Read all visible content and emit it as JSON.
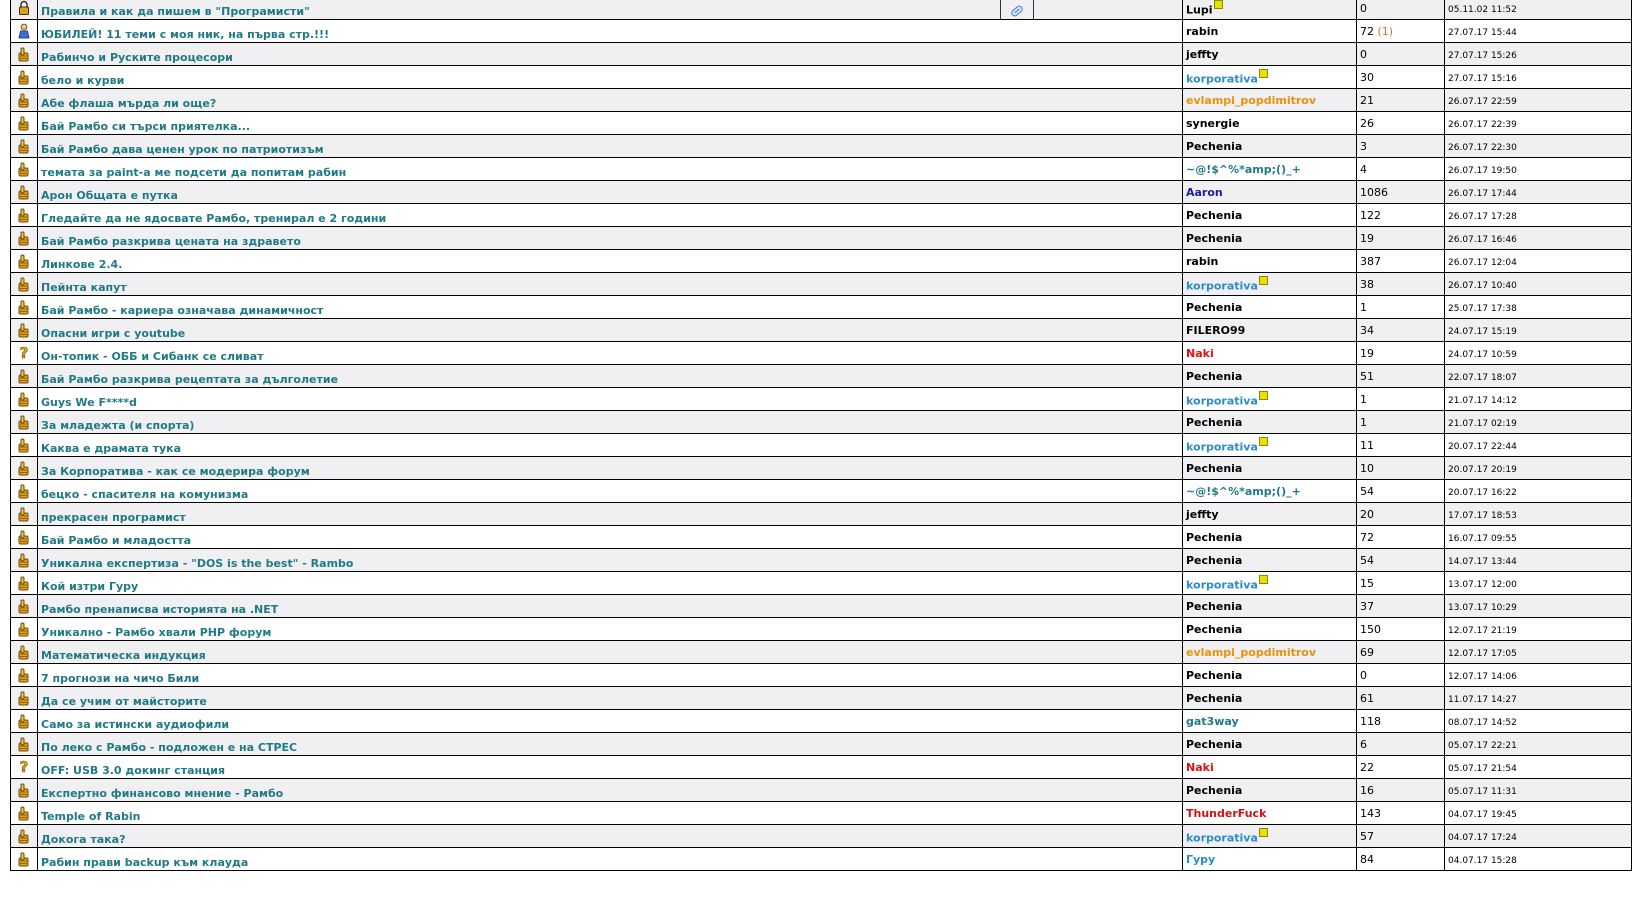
{
  "colors": {
    "title": "#1f7a85",
    "name_black": "#000000",
    "name_blue": "#2a8ccc",
    "name_orange": "#e8920c",
    "name_navy": "#1b1ba8",
    "name_red": "#dd1111",
    "name_teal": "#1f7a85",
    "name_darkred": "#cc1111",
    "new_count": "#e07030"
  },
  "topics": [
    {
      "icon": "lock-icon",
      "title": "Правила и как да пишем в \"Програмисти\"",
      "author": "Lupi",
      "author_color": "name_black",
      "badge": true,
      "replies": "0",
      "new": "",
      "date": "05.11.02 11:52"
    },
    {
      "icon": "person-icon",
      "title": "ЮБИЛЕЙ! 11 теми с моя ник, на първа стр.!!!",
      "author": "rabin",
      "author_color": "name_black",
      "badge": false,
      "replies": "72",
      "new": "(1)",
      "date": "27.07.17 15:44"
    },
    {
      "icon": "thumb-icon",
      "title": "Рабинчо и Руските процесори",
      "author": "jeffty",
      "author_color": "name_black",
      "badge": false,
      "replies": "0",
      "new": "",
      "date": "27.07.17 15:26"
    },
    {
      "icon": "thumb-icon",
      "title": "бело и курви",
      "author": "korporativa",
      "author_color": "name_blue",
      "badge": true,
      "replies": "30",
      "new": "",
      "date": "27.07.17 15:16"
    },
    {
      "icon": "thumb-icon",
      "title": "Абе флаша мърда ли още?",
      "author": "evlampi_popdimitrov",
      "author_color": "name_orange",
      "badge": false,
      "replies": "21",
      "new": "",
      "date": "26.07.17 22:59"
    },
    {
      "icon": "thumb-icon",
      "title": "Бай Рамбо си търси приятелка...",
      "author": "synergie",
      "author_color": "name_black",
      "badge": false,
      "replies": "26",
      "new": "",
      "date": "26.07.17 22:39"
    },
    {
      "icon": "thumb-icon",
      "title": "Бай Рамбо дава ценен урок по патриотизъм",
      "author": "Pechenia",
      "author_color": "name_black",
      "badge": false,
      "replies": "3",
      "new": "",
      "date": "26.07.17 22:30"
    },
    {
      "icon": "thumb-icon",
      "title": "темата за paint-а ме подсети да попитам рабин",
      "author": "~@!$^%*amp;()_+",
      "author_color": "name_teal",
      "badge": false,
      "replies": "4",
      "new": "",
      "date": "26.07.17 19:50"
    },
    {
      "icon": "thumb-icon",
      "title": "Арон Общата е путка",
      "author": "Aaron",
      "author_color": "name_navy",
      "badge": false,
      "replies": "1086",
      "new": "",
      "date": "26.07.17 17:44"
    },
    {
      "icon": "thumb-icon",
      "title": "Гледайте да не ядосвате Рамбо, тренирал е 2 години",
      "author": "Pechenia",
      "author_color": "name_black",
      "badge": false,
      "replies": "122",
      "new": "",
      "date": "26.07.17 17:28"
    },
    {
      "icon": "thumb-icon",
      "title": "Бай Рамбо разкрива цената на здравето",
      "author": "Pechenia",
      "author_color": "name_black",
      "badge": false,
      "replies": "19",
      "new": "",
      "date": "26.07.17 16:46"
    },
    {
      "icon": "thumb-icon",
      "title": "Линкове 2.4.",
      "author": "rabin",
      "author_color": "name_black",
      "badge": false,
      "replies": "387",
      "new": "",
      "date": "26.07.17 12:04"
    },
    {
      "icon": "thumb-icon",
      "title": "Пейнта капут",
      "author": "korporativa",
      "author_color": "name_blue",
      "badge": true,
      "replies": "38",
      "new": "",
      "date": "26.07.17 10:40"
    },
    {
      "icon": "thumb-icon",
      "title": "Бай Рамбо - кариера означава динамичност",
      "author": "Pechenia",
      "author_color": "name_black",
      "badge": false,
      "replies": "1",
      "new": "",
      "date": "25.07.17 17:38"
    },
    {
      "icon": "thumb-icon",
      "title": "Опасни игри с youtube",
      "author": "FILERO99",
      "author_color": "name_black",
      "badge": false,
      "replies": "34",
      "new": "",
      "date": "24.07.17 15:19"
    },
    {
      "icon": "question-icon",
      "title": "Он-топик - ОББ и Сибанк се сливат",
      "author": "Naki",
      "author_color": "name_red",
      "badge": false,
      "replies": "19",
      "new": "",
      "date": "24.07.17 10:59"
    },
    {
      "icon": "thumb-icon",
      "title": "Бай Рамбо разкрива рецептата за дълголетие",
      "author": "Pechenia",
      "author_color": "name_black",
      "badge": false,
      "replies": "51",
      "new": "",
      "date": "22.07.17 18:07"
    },
    {
      "icon": "thumb-icon",
      "title": "Guys We F****d",
      "author": "korporativa",
      "author_color": "name_blue",
      "badge": true,
      "replies": "1",
      "new": "",
      "date": "21.07.17 14:12"
    },
    {
      "icon": "thumb-icon",
      "title": "За младежта (и спорта)",
      "author": "Pechenia",
      "author_color": "name_black",
      "badge": false,
      "replies": "1",
      "new": "",
      "date": "21.07.17 02:19"
    },
    {
      "icon": "thumb-icon",
      "title": "Каква е драмата тука",
      "author": "korporativa",
      "author_color": "name_blue",
      "badge": true,
      "replies": "11",
      "new": "",
      "date": "20.07.17 22:44"
    },
    {
      "icon": "thumb-icon",
      "title": "За Корпоратива - как се модерира форум",
      "author": "Pechenia",
      "author_color": "name_black",
      "badge": false,
      "replies": "10",
      "new": "",
      "date": "20.07.17 20:19"
    },
    {
      "icon": "thumb-icon",
      "title": "бецко - спасителя на комунизма",
      "author": "~@!$^%*amp;()_+",
      "author_color": "name_teal",
      "badge": false,
      "replies": "54",
      "new": "",
      "date": "20.07.17 16:22"
    },
    {
      "icon": "thumb-icon",
      "title": "прекрасен програмист",
      "author": "jeffty",
      "author_color": "name_black",
      "badge": false,
      "replies": "20",
      "new": "",
      "date": "17.07.17 18:53"
    },
    {
      "icon": "thumb-icon",
      "title": "Бай Рамбо и младостта",
      "author": "Pechenia",
      "author_color": "name_black",
      "badge": false,
      "replies": "72",
      "new": "",
      "date": "16.07.17 09:55"
    },
    {
      "icon": "thumb-icon",
      "title": "Уникална експертиза - \"DOS is the best\" - Rambo",
      "author": "Pechenia",
      "author_color": "name_black",
      "badge": false,
      "replies": "54",
      "new": "",
      "date": "14.07.17 13:44"
    },
    {
      "icon": "thumb-icon",
      "title": "Кой изтри Гуру",
      "author": "korporativa",
      "author_color": "name_blue",
      "badge": true,
      "replies": "15",
      "new": "",
      "date": "13.07.17 12:00"
    },
    {
      "icon": "thumb-icon",
      "title": "Рамбо пренаписва историята на .NET",
      "author": "Pechenia",
      "author_color": "name_black",
      "badge": false,
      "replies": "37",
      "new": "",
      "date": "13.07.17 10:29"
    },
    {
      "icon": "thumb-icon",
      "title": "Уникално - Рамбо хвали PHP форум",
      "author": "Pechenia",
      "author_color": "name_black",
      "badge": false,
      "replies": "150",
      "new": "",
      "date": "12.07.17 21:19"
    },
    {
      "icon": "thumb-icon",
      "title": "Математическа индукция",
      "author": "evlampi_popdimitrov",
      "author_color": "name_orange",
      "badge": false,
      "replies": "69",
      "new": "",
      "date": "12.07.17 17:05"
    },
    {
      "icon": "thumb-icon",
      "title": "7 прогнози на чичо Били",
      "author": "Pechenia",
      "author_color": "name_black",
      "badge": false,
      "replies": "0",
      "new": "",
      "date": "12.07.17 14:06"
    },
    {
      "icon": "thumb-icon",
      "title": "Да се учим от майсторите",
      "author": "Pechenia",
      "author_color": "name_black",
      "badge": false,
      "replies": "61",
      "new": "",
      "date": "11.07.17 14:27"
    },
    {
      "icon": "thumb-icon",
      "title": "Само за истински аудиофили",
      "author": "gat3way",
      "author_color": "name_teal",
      "badge": false,
      "replies": "118",
      "new": "",
      "date": "08.07.17 14:52"
    },
    {
      "icon": "thumb-icon",
      "title": "По леко с Рамбо - подложен е на СТРЕС",
      "author": "Pechenia",
      "author_color": "name_black",
      "badge": false,
      "replies": "6",
      "new": "",
      "date": "05.07.17 22:21"
    },
    {
      "icon": "question-icon",
      "title": "OFF: USB 3.0 докинг станция",
      "author": "Naki",
      "author_color": "name_red",
      "badge": false,
      "replies": "22",
      "new": "",
      "date": "05.07.17 21:54"
    },
    {
      "icon": "thumb-icon",
      "title": "Експертно финансово мнение - Рамбо",
      "author": "Pechenia",
      "author_color": "name_black",
      "badge": false,
      "replies": "16",
      "new": "",
      "date": "05.07.17 11:31"
    },
    {
      "icon": "thumb-icon",
      "title": "Temple of Rabin",
      "author": "ThunderFuck",
      "author_color": "name_darkred",
      "badge": false,
      "replies": "143",
      "new": "",
      "date": "04.07.17 19:45"
    },
    {
      "icon": "thumb-icon",
      "title": "Докога така?",
      "author": "korporativa",
      "author_color": "name_blue",
      "badge": true,
      "replies": "57",
      "new": "",
      "date": "04.07.17 17:24"
    },
    {
      "icon": "thumb-icon",
      "title": "Рабин прави backup към клауда",
      "author": "Гуру",
      "author_color": "name_blue",
      "badge": false,
      "replies": "84",
      "new": "",
      "date": "04.07.17 15:28"
    }
  ]
}
